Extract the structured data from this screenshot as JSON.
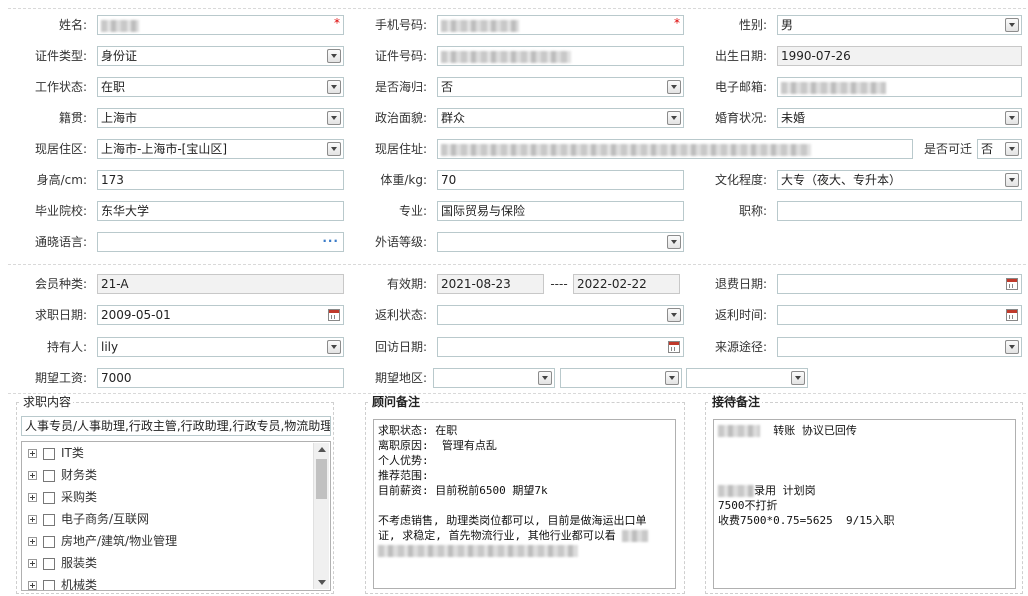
{
  "form": {
    "name_label": "姓名:",
    "phone_label": "手机号码:",
    "gender_label": "性别:",
    "gender_value": "男",
    "id_type_label": "证件类型:",
    "id_type_value": "身份证",
    "id_number_label": "证件号码:",
    "birthdate_label": "出生日期:",
    "birthdate_value": "1990-07-26",
    "work_status_label": "工作状态:",
    "work_status_value": "在职",
    "returnee_label": "是否海归:",
    "returnee_value": "否",
    "email_label": "电子邮箱:",
    "origin_label": "籍贯:",
    "origin_value": "上海市",
    "political_label": "政治面貌:",
    "political_value": "群众",
    "marital_label": "婚育状况:",
    "marital_value": "未婚",
    "district_label": "现居住区:",
    "district_value": "上海市-上海市-[宝山区]",
    "address_label": "现居住址:",
    "relocate_label": "是否可迁",
    "relocate_value": "否",
    "height_label": "身高/cm:",
    "height_value": "173",
    "weight_label": "体重/kg:",
    "weight_value": "70",
    "education_label": "文化程度:",
    "education_value": "大专（夜大、专升本）",
    "school_label": "毕业院校:",
    "school_value": "东华大学",
    "major_label": "专业:",
    "major_value": "国际贸易与保险",
    "title_label": "职称:",
    "language_label": "通晓语言:",
    "language_more": "···",
    "foreign_level_label": "外语等级:"
  },
  "membership": {
    "type_label": "会员种类:",
    "type_value": "21-A",
    "valid_label": "有效期:",
    "valid_from": "2021-08-23",
    "valid_sep": "----",
    "valid_to": "2022-02-22",
    "refund_date_label": "退费日期:",
    "job_date_label": "求职日期:",
    "job_date_value": "2009-05-01",
    "rebate_status_label": "返利状态:",
    "rebate_time_label": "返利时间:",
    "holder_label": "持有人:",
    "holder_value": "lily",
    "visit_date_label": "回访日期:",
    "source_label": "来源途径:",
    "salary_label": "期望工资:",
    "salary_value": "7000",
    "region_label": "期望地区:"
  },
  "job_panel": {
    "title": "求职内容",
    "selected_text": "人事专员/人事助理,行政主管,行政助理,行政专员,物流助理",
    "categories": [
      "IT类",
      "财务类",
      "采购类",
      "电子商务/互联网",
      "房地产/建筑/物业管理",
      "服装类",
      "机械类"
    ]
  },
  "advisor_panel": {
    "title": "顾问备注",
    "lines": [
      "求职状态: 在职",
      "离职原因:  管理有点乱",
      "个人优势:",
      "推荐范围:",
      "目前薪资: 目前税前6500 期望7k",
      "",
      "不考虑销售, 助理类岗位都可以, 目前是做海运出口单",
      "证, 求稳定, 首先物流行业, 其他行业都可以看"
    ]
  },
  "reception_panel": {
    "title": "接待备注",
    "line1": "转账 协议已回传",
    "line2": "录用 计划岗",
    "line3": "7500不打折",
    "line4": "收费7500*0.75=5625  9/15入职"
  },
  "icons": [
    "dropdown-arrow-icon",
    "calendar-icon",
    "more-dots-icon",
    "expand-plus-icon",
    "checkbox-icon"
  ],
  "colors": {
    "required_star": "#dd0000",
    "field_border": "#b9c9cc",
    "readonly_bg": "#f2f2f2",
    "more_dots": "#3a7bc8"
  }
}
